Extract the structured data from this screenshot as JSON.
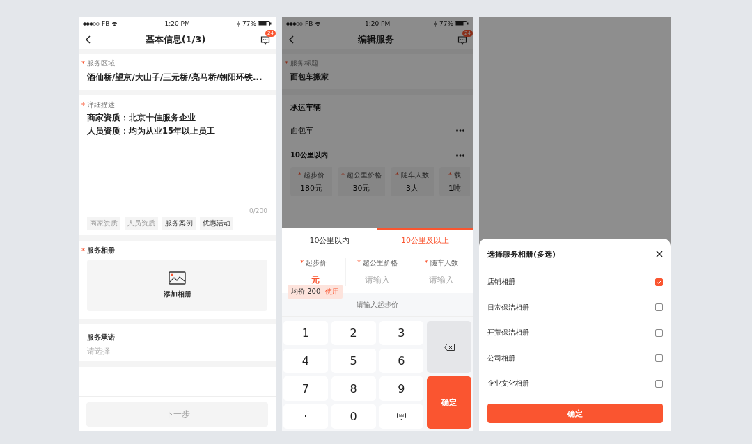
{
  "basic_info": {
    "status_bar": {
      "carrier": "FB",
      "time": "1:20 PM",
      "battery": "77%"
    },
    "title": "基本信息(1/3)",
    "message_badge": "24",
    "area": {
      "required": "*",
      "label": "服务区域",
      "value": "酒仙桥/望京/大山子/三元桥/亮马桥/朝阳环铁..."
    },
    "description": {
      "required": "*",
      "label": "详细描述",
      "lines": [
        "商家资质：北京十佳服务企业",
        "人员资质：均为从业15年以上员工"
      ],
      "counter": "0/200",
      "tags": [
        {
          "label": "商家资质",
          "disabled": true
        },
        {
          "label": "人员资质",
          "disabled": true
        },
        {
          "label": "服务案例",
          "disabled": false
        },
        {
          "label": "优惠活动",
          "disabled": false
        }
      ]
    },
    "album": {
      "required": "*",
      "label": "服务相册",
      "add": "添加相册"
    },
    "promise": {
      "label": "服务承诺",
      "placeholder": "请选择"
    },
    "next_button": {
      "label": "下一步",
      "disabled": true
    }
  },
  "edit_service": {
    "status_bar": {
      "carrier": "FB",
      "time": "1:20 PM",
      "battery": "77%"
    },
    "title": "编辑服务",
    "message_badge": "24",
    "service_title": {
      "required": "*",
      "label": "服务标题",
      "value": "面包车搬家"
    },
    "vehicle_heading": "承运车辆",
    "rows": [
      "面包车",
      "10公里以内"
    ],
    "price_cards": [
      {
        "required": "*",
        "label": "起步价",
        "value": "180元"
      },
      {
        "required": "*",
        "label": "超公里价格",
        "value": "30元"
      },
      {
        "required": "*",
        "label": "随车人数",
        "value": "3人"
      },
      {
        "required": "*",
        "label": "载",
        "value": "1吨"
      }
    ],
    "tabs": [
      {
        "label": "10公里以内",
        "selected": false
      },
      {
        "label": "10公里及以上",
        "selected": true
      }
    ],
    "fields": [
      {
        "required": "*",
        "label": "起步价",
        "value": "元",
        "focused": true
      },
      {
        "required": "*",
        "label": "超公里价格",
        "placeholder": "请输入",
        "focused": false
      },
      {
        "required": "*",
        "label": "随车人数",
        "placeholder": "请输入",
        "focused": false
      }
    ],
    "tooltip": {
      "text": "均价 200",
      "action": "使用"
    },
    "hint": "请输入起步价",
    "keys": [
      {
        "kind": "digit",
        "label": "1"
      },
      {
        "kind": "digit",
        "label": "2"
      },
      {
        "kind": "digit",
        "label": "3"
      },
      {
        "kind": "digit",
        "label": "4"
      },
      {
        "kind": "digit",
        "label": "5"
      },
      {
        "kind": "digit",
        "label": "6"
      },
      {
        "kind": "digit",
        "label": "7"
      },
      {
        "kind": "digit",
        "label": "8"
      },
      {
        "kind": "digit",
        "label": "9"
      },
      {
        "kind": "point",
        "label": "."
      },
      {
        "kind": "digit",
        "label": "0"
      }
    ],
    "confirm": "确定"
  },
  "album_picker": {
    "title": "选择服务相册(多选)",
    "items": [
      {
        "label": "店铺相册",
        "checked": true
      },
      {
        "label": "日常保洁相册",
        "checked": false
      },
      {
        "label": "开荒保洁相册",
        "checked": false
      },
      {
        "label": "公司相册",
        "checked": false
      },
      {
        "label": "企业文化相册",
        "checked": false
      }
    ],
    "confirm": "确定"
  }
}
